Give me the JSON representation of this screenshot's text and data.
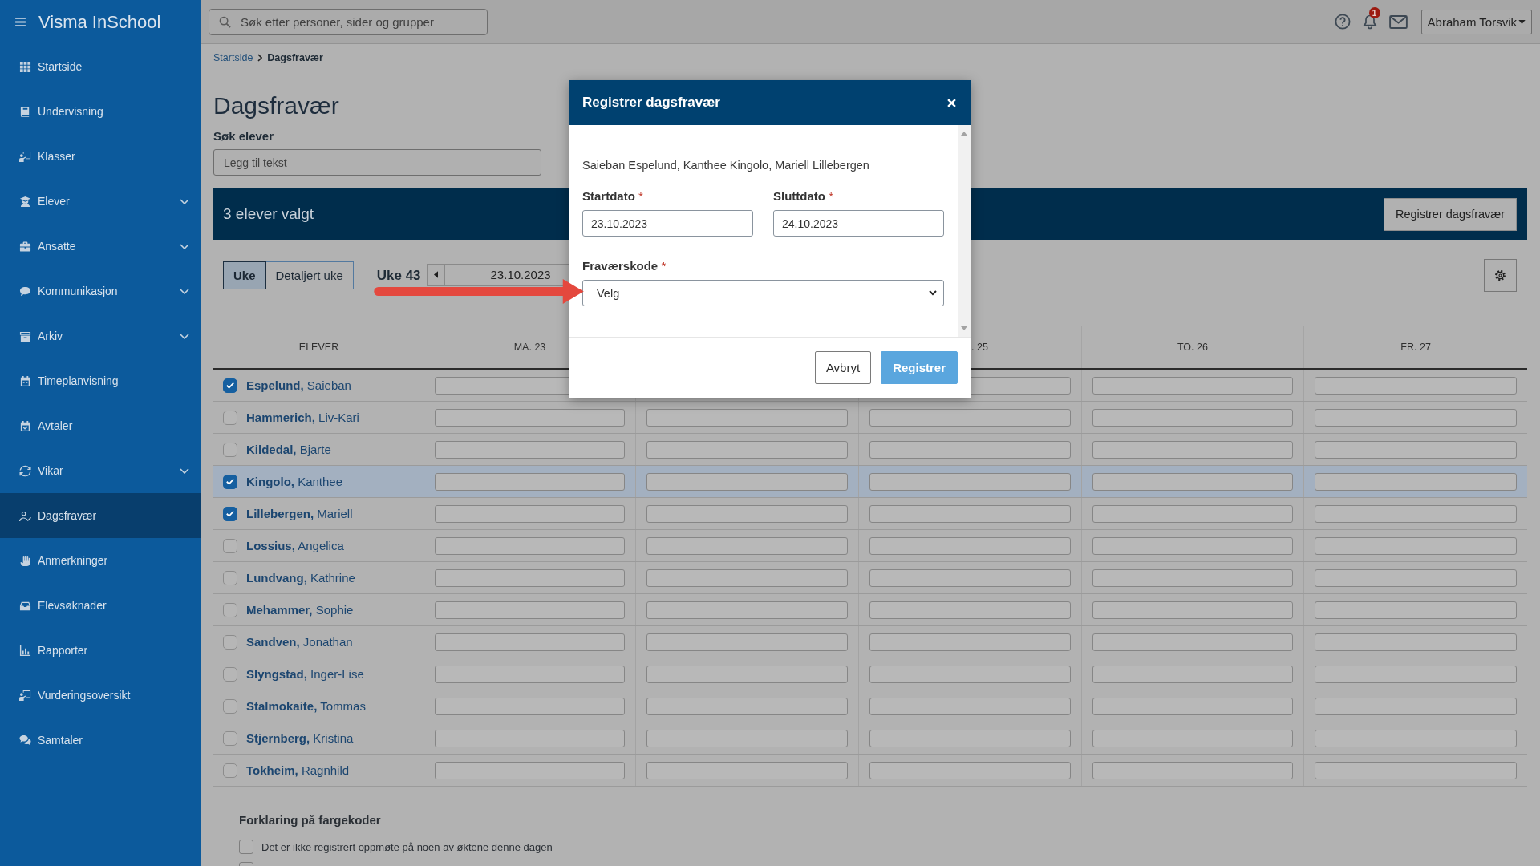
{
  "sidebar": {
    "brand": "Visma InSchool",
    "items": [
      {
        "label": "Startside",
        "expandable": false,
        "selected": false
      },
      {
        "label": "Undervisning",
        "expandable": false,
        "selected": false
      },
      {
        "label": "Klasser",
        "expandable": false,
        "selected": false
      },
      {
        "label": "Elever",
        "expandable": true,
        "selected": false
      },
      {
        "label": "Ansatte",
        "expandable": true,
        "selected": false
      },
      {
        "label": "Kommunikasjon",
        "expandable": true,
        "selected": false
      },
      {
        "label": "Arkiv",
        "expandable": true,
        "selected": false
      },
      {
        "label": "Timeplanvisning",
        "expandable": false,
        "selected": false
      },
      {
        "label": "Avtaler",
        "expandable": false,
        "selected": false
      },
      {
        "label": "Vikar",
        "expandable": true,
        "selected": false
      },
      {
        "label": "Dagsfravær",
        "expandable": false,
        "selected": true
      },
      {
        "label": "Anmerkninger",
        "expandable": false,
        "selected": false
      },
      {
        "label": "Elevsøknader",
        "expandable": false,
        "selected": false
      },
      {
        "label": "Rapporter",
        "expandable": false,
        "selected": false
      },
      {
        "label": "Vurderingsoversikt",
        "expandable": false,
        "selected": false
      },
      {
        "label": "Samtaler",
        "expandable": false,
        "selected": false
      }
    ]
  },
  "top_bar": {
    "search": {
      "placeholder": "Søk etter personer, sider og grupper"
    },
    "notification_count": "1",
    "user": "Abraham Torsvik"
  },
  "breadcrumb": [
    {
      "label": "Startside",
      "current": false
    },
    {
      "label": "Dagsfravær",
      "current": true
    }
  ],
  "page_title": "Dagsfravær",
  "student_search": {
    "label": "Søk elever",
    "placeholder": "Legg til tekst"
  },
  "selection_bar": {
    "text": "3 elever valgt",
    "button": "Registrer dagsfravær"
  },
  "view_tabs": [
    {
      "label": "Uke",
      "selected": true
    },
    {
      "label": "Detaljert uke",
      "selected": false
    }
  ],
  "week": {
    "label": "Uke 43",
    "date": "23.10.2023"
  },
  "table": {
    "columns": [
      {
        "label": "ELEVER",
        "clipped": false
      },
      {
        "label": "MA. 23",
        "clipped": false
      },
      {},
      {
        "label": ". 25",
        "clipped": true
      },
      {
        "label": "TO. 26",
        "clipped": false
      },
      {
        "label": "FR. 27",
        "clipped": false
      }
    ],
    "rows": [
      {
        "name": "**Espelund,** Saieban",
        "checked": true,
        "highlighted": false
      },
      {
        "name": "**Hammerich,** Liv-Kari",
        "checked": false,
        "highlighted": false
      },
      {
        "name": "**Kildedal,** Bjarte",
        "checked": false,
        "highlighted": false
      },
      {
        "name": "**Kingolo,** Kanthee",
        "checked": true,
        "highlighted": true
      },
      {
        "name": "**Lillebergen,** Mariell",
        "checked": true,
        "highlighted": false
      },
      {
        "name": "**Lossius,** Angelica",
        "checked": false,
        "highlighted": false
      },
      {
        "name": "**Lundvang,** Kathrine",
        "checked": false,
        "highlighted": false
      },
      {
        "name": "**Mehammer,** Sophie",
        "checked": false,
        "highlighted": false
      },
      {
        "name": "**Sandven,** Jonathan",
        "checked": false,
        "highlighted": false
      },
      {
        "name": "**Slyngstad,** Inger-Lise",
        "checked": false,
        "highlighted": false
      },
      {
        "name": "**Stalmokaite,** Tommas",
        "checked": false,
        "highlighted": false
      },
      {
        "name": "**Stjernberg,** Kristina",
        "checked": false,
        "highlighted": false
      },
      {
        "name": "**Tokheim,** Ragnhild",
        "checked": false,
        "highlighted": false
      }
    ]
  },
  "legend": {
    "title": "Forklaring på fargekoder",
    "items": [
      {
        "text": "Det er ikke registrert oppmøte på noen av øktene denne dagen",
        "color": "#b4b4b4"
      },
      {
        "color": "#b4b4b4"
      }
    ]
  },
  "dialog": {
    "title": "Registrer dagsfravær",
    "students": "Saieban Espelund, Kanthee Kingolo, Mariell Lillebergen",
    "fields": [
      {
        "kind": "date",
        "label": "Startdato",
        "required_mark": "*",
        "value": "23.10.2023"
      },
      {
        "kind": "date",
        "label": "Sluttdato",
        "required_mark": "*",
        "value": "24.10.2023"
      },
      {
        "kind": "select",
        "label": "Fraværskode",
        "required_mark": "*",
        "value": "Velg"
      }
    ],
    "buttons": [
      {
        "kind": "secondary",
        "label": "Avbryt"
      },
      {
        "kind": "primary",
        "label": "Registrer"
      }
    ]
  }
}
